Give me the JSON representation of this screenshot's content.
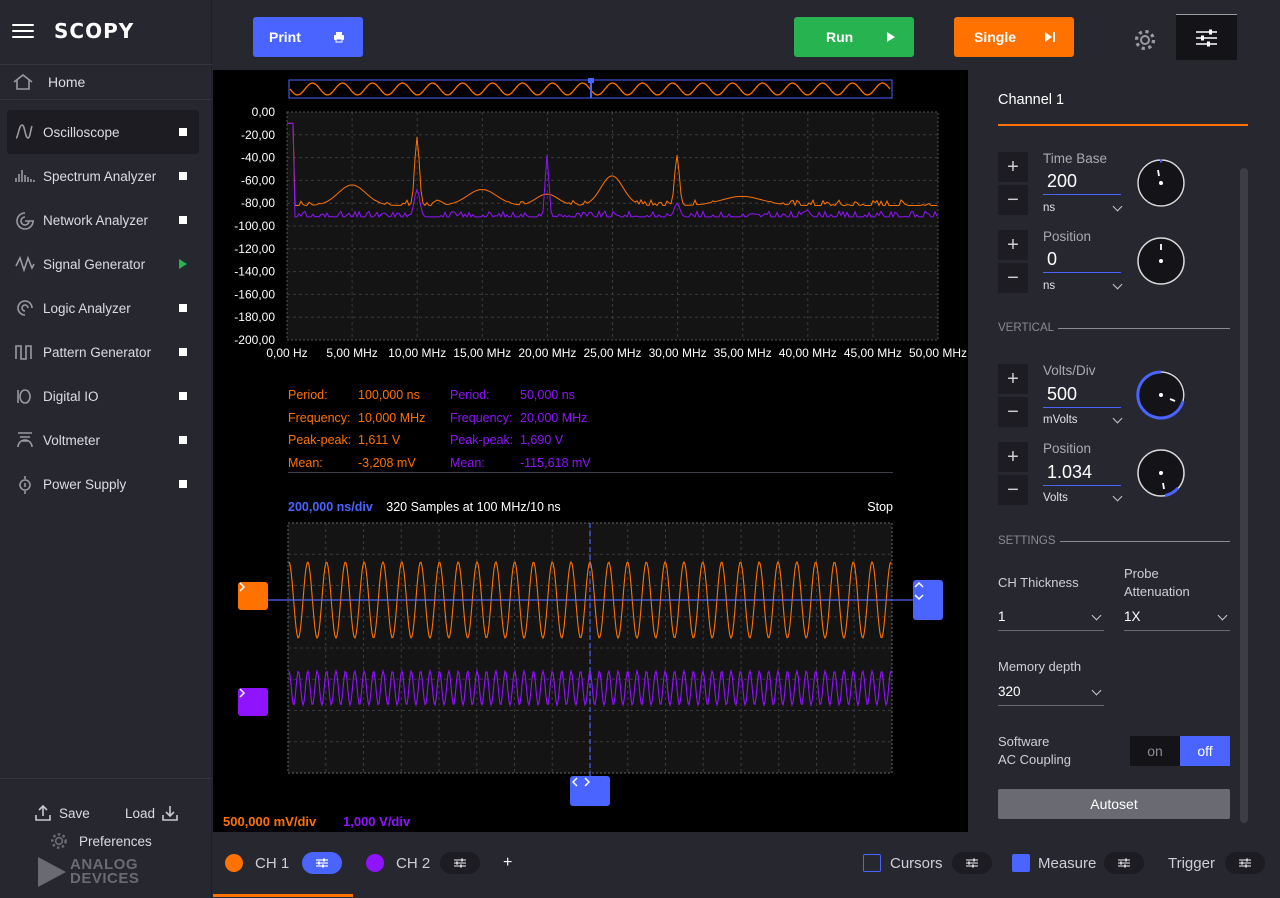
{
  "app": {
    "name": "SCOPY"
  },
  "sidebar": {
    "home_label": "Home",
    "tools": [
      {
        "label": "Oscilloscope",
        "icon": "oscilloscope-icon",
        "active": true,
        "indicator": "square"
      },
      {
        "label": "Spectrum Analyzer",
        "icon": "spectrum-icon",
        "indicator": "square"
      },
      {
        "label": "Network Analyzer",
        "icon": "network-icon",
        "indicator": "square"
      },
      {
        "label": "Signal Generator",
        "icon": "signal-icon",
        "indicator": "play"
      },
      {
        "label": "Logic Analyzer",
        "icon": "logic-icon",
        "indicator": "square"
      },
      {
        "label": "Pattern Generator",
        "icon": "pattern-icon",
        "indicator": "square"
      },
      {
        "label": "Digital IO",
        "icon": "digital-io-icon",
        "indicator": "square"
      },
      {
        "label": "Voltmeter",
        "icon": "voltmeter-icon",
        "indicator": "square"
      },
      {
        "label": "Power Supply",
        "icon": "power-supply-icon",
        "indicator": "square"
      }
    ],
    "save_label": "Save",
    "load_label": "Load",
    "preferences_label": "Preferences",
    "logo_line1": "ANALOG",
    "logo_line2": "DEVICES"
  },
  "toolbar": {
    "print_label": "Print",
    "run_label": "Run",
    "single_label": "Single"
  },
  "colors": {
    "ch1": "#ff7200",
    "ch2": "#9013fe",
    "accent": "#4a64ff",
    "run": "#27b34f"
  },
  "fft": {
    "y_ticks": [
      "0,00",
      "-20,00",
      "-40,00",
      "-60,00",
      "-80,00",
      "-100,00",
      "-120,00",
      "-140,00",
      "-160,00",
      "-180,00",
      "-200,00"
    ],
    "x_ticks": [
      "0,00 Hz",
      "5,00 MHz",
      "10,00 MHz",
      "15,00 MHz",
      "20,00 MHz",
      "25,00 MHz",
      "30,00 MHz",
      "35,00 MHz",
      "40,00 MHz",
      "45,00 MHz",
      "50,00 MHz"
    ]
  },
  "measurements": {
    "ch1": [
      {
        "key": "Period:",
        "value": "100,000 ns"
      },
      {
        "key": "Frequency:",
        "value": "10,000 MHz"
      },
      {
        "key": "Peak-peak:",
        "value": "1,611 V"
      },
      {
        "key": "Mean:",
        "value": "-3,208 mV"
      }
    ],
    "ch2": [
      {
        "key": "Period:",
        "value": "50,000 ns"
      },
      {
        "key": "Frequency:",
        "value": "20,000 MHz"
      },
      {
        "key": "Peak-peak:",
        "value": "1,690 V"
      },
      {
        "key": "Mean:",
        "value": "-115,618 mV"
      }
    ]
  },
  "timebase_info": {
    "time_div": "200,000 ns/div",
    "samples": "320 Samples at 100 MHz/10 ns",
    "status": "Stop"
  },
  "scales": {
    "ch1": "500,000 mV/div",
    "ch2": "1,000 V/div"
  },
  "panel": {
    "title": "Channel 1",
    "time_base": {
      "label": "Time Base",
      "value": "200",
      "unit": "ns"
    },
    "h_position": {
      "label": "Position",
      "value": "0",
      "unit": "ns"
    },
    "vertical_header": "VERTICAL",
    "volts_div": {
      "label": "Volts/Div",
      "value": "500",
      "unit": "mVolts"
    },
    "v_position": {
      "label": "Position",
      "value": "1.034",
      "unit": "Volts"
    },
    "settings_header": "SETTINGS",
    "ch_thickness": {
      "label": "CH Thickness",
      "value": "1"
    },
    "probe_attenuation": {
      "label_line1": "Probe",
      "label_line2": "Attenuation",
      "value": "1X"
    },
    "memory_depth": {
      "label": "Memory depth",
      "value": "320"
    },
    "ac_coupling": {
      "label_line1": "Software",
      "label_line2": "AC Coupling",
      "on": "on",
      "off": "off",
      "selected": "off"
    },
    "autoset_label": "Autoset"
  },
  "bottom": {
    "ch1_label": "CH 1",
    "ch2_label": "CH 2",
    "add_label": "+",
    "cursors_label": "Cursors",
    "measure_label": "Measure",
    "trigger_label": "Trigger"
  }
}
